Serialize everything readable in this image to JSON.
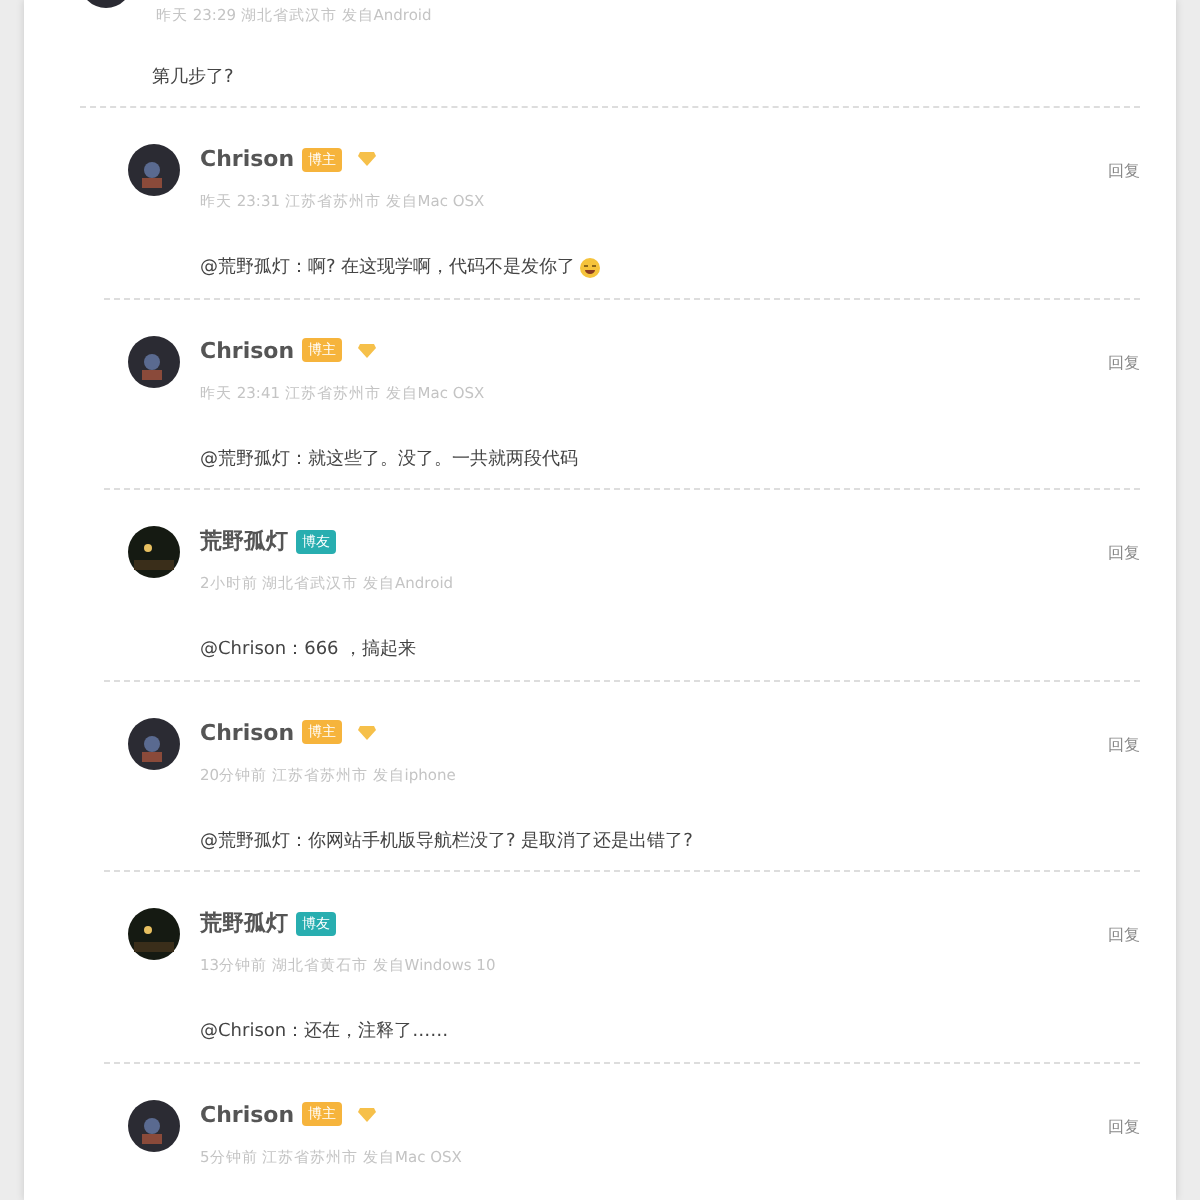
{
  "top_comment": {
    "meta": "昨天 23:29 湖北省武汉市 发自Android",
    "text": "第几步了?"
  },
  "replies": [
    {
      "name": "Chrison",
      "badge": "博主",
      "color": "#f6b43c",
      "vip": true,
      "meta": "昨天 23:31 江苏省苏州市 发自Mac OSX",
      "text": "@荒野孤灯：啊? 在这现学啊，代码不是发你了",
      "emoji": true,
      "reply": "回复"
    },
    {
      "name": "Chrison",
      "badge": "博主",
      "color": "#f6b43c",
      "vip": true,
      "meta": "昨天 23:41 江苏省苏州市 发自Mac OSX",
      "text": "@荒野孤灯：就这些了。没了。一共就两段代码",
      "emoji": false,
      "reply": "回复"
    },
    {
      "name": "荒野孤灯",
      "badge": "博友",
      "color": "#28aeb0",
      "vip": false,
      "meta": "2小时前 湖北省武汉市 发自Android",
      "text": "@Chrison：666 ，搞起来",
      "emoji": false,
      "reply": "回复"
    },
    {
      "name": "Chrison",
      "badge": "博主",
      "color": "#f6b43c",
      "vip": true,
      "meta": "20分钟前 江苏省苏州市 发自iphone",
      "text": "@荒野孤灯：你网站手机版导航栏没了? 是取消了还是出错了?",
      "emoji": false,
      "reply": "回复"
    },
    {
      "name": "荒野孤灯",
      "badge": "博友",
      "color": "#28aeb0",
      "vip": false,
      "meta": "13分钟前 湖北省黄石市 发自Windows 10",
      "text": "@Chrison：还在，注释了……",
      "emoji": false,
      "reply": "回复"
    },
    {
      "name": "Chrison",
      "badge": "博主",
      "color": "#f6b43c",
      "vip": true,
      "meta": "5分钟前 江苏省苏州市 发自Mac OSX",
      "reply": "回复"
    }
  ]
}
